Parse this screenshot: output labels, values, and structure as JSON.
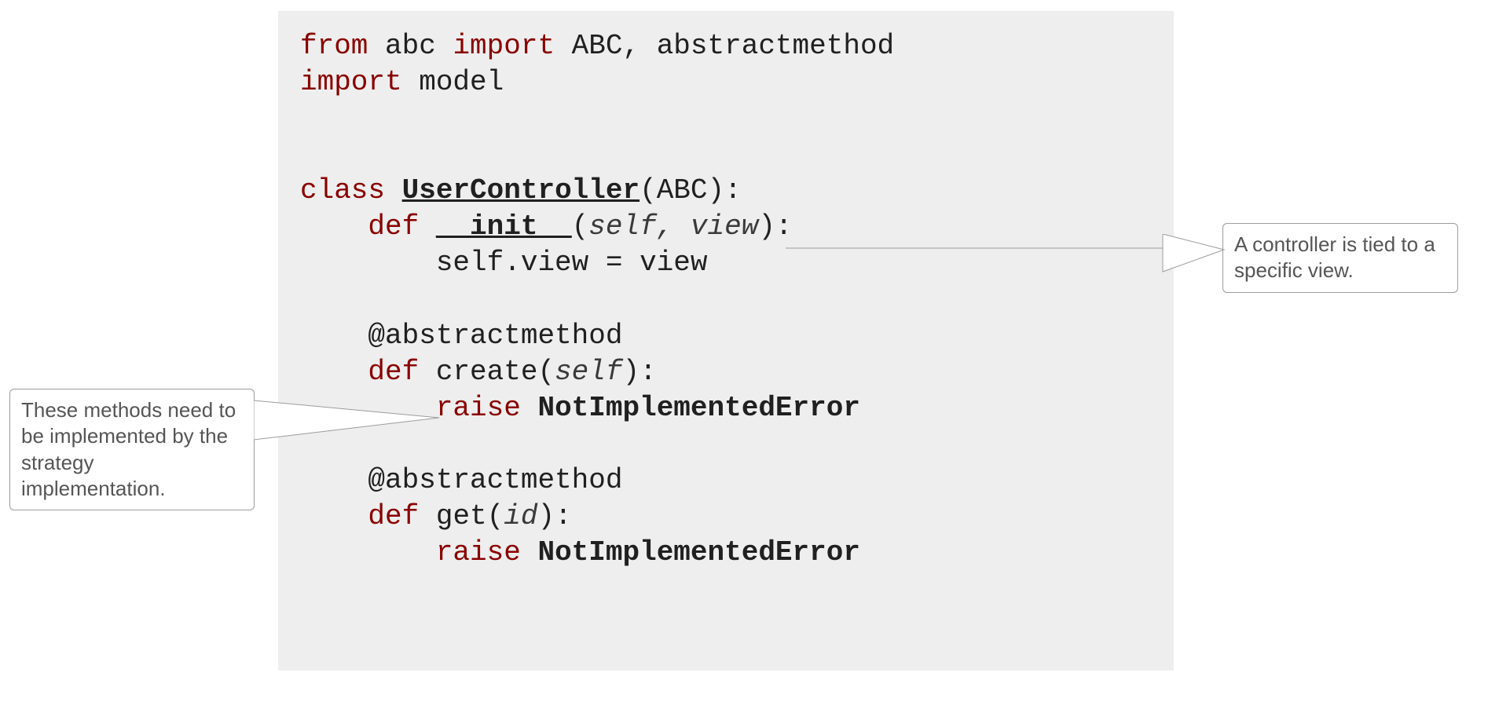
{
  "code": {
    "line1": {
      "kw1": "from",
      "t1": " abc ",
      "kw2": "import",
      "t2": " ABC, abstractmethod"
    },
    "line2": {
      "kw1": "import",
      "t1": " model"
    },
    "blank1": "",
    "blank2": "",
    "line5": {
      "kw1": "class",
      "sp": " ",
      "cls": "UserController",
      "t1": "(ABC):"
    },
    "line6": {
      "indent": "    ",
      "kw1": "def",
      "sp": " ",
      "fn": "__init__",
      "paren_open": "(",
      "prm": "self, view",
      "paren_close": "):"
    },
    "line7": {
      "indent": "        ",
      "t1": "self.view = view"
    },
    "blank3": "",
    "line9": {
      "indent": "    ",
      "t1": "@abstractmethod"
    },
    "line10": {
      "indent": "    ",
      "kw1": "def",
      "t1": " create(",
      "prm": "self",
      "t2": "):"
    },
    "line11": {
      "indent": "        ",
      "kw1": "raise",
      "sp": " ",
      "err": "NotImplementedError"
    },
    "blank4": "",
    "line13": {
      "indent": "    ",
      "t1": "@abstractmethod"
    },
    "line14": {
      "indent": "    ",
      "kw1": "def",
      "t1": " get(",
      "prm": "id",
      "t2": "):"
    },
    "line15": {
      "indent": "        ",
      "kw1": "raise",
      "sp": " ",
      "err": "NotImplementedError"
    }
  },
  "callouts": {
    "left": "These methods need to be implemented by the strategy implementation.",
    "right": "A controller is tied to a specific view."
  }
}
